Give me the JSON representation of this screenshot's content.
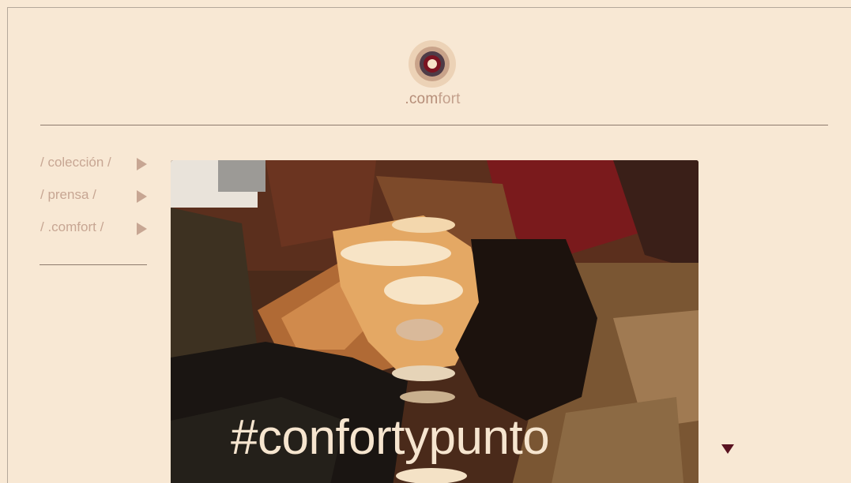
{
  "brand": {
    "prefix": ".com",
    "suffix": "fort",
    "logo_icon": "concentric-circles-logo"
  },
  "nav": {
    "items": [
      {
        "label": "/ colección /",
        "icon": "play-arrow-icon"
      },
      {
        "label": "/ prensa /",
        "icon": "play-arrow-icon"
      },
      {
        "label": "/ .comfort /",
        "icon": "play-arrow-icon"
      }
    ]
  },
  "hero": {
    "hashtag": "#confortypunto",
    "image": "posterized-photo-person-lying-hand-over-face"
  },
  "scroll": {
    "icon": "down-triangle-icon"
  },
  "colors": {
    "background": "#f8e8d4",
    "nav_text": "#c7a693",
    "accent": "#5a1220",
    "rule": "#8d7a6c"
  }
}
